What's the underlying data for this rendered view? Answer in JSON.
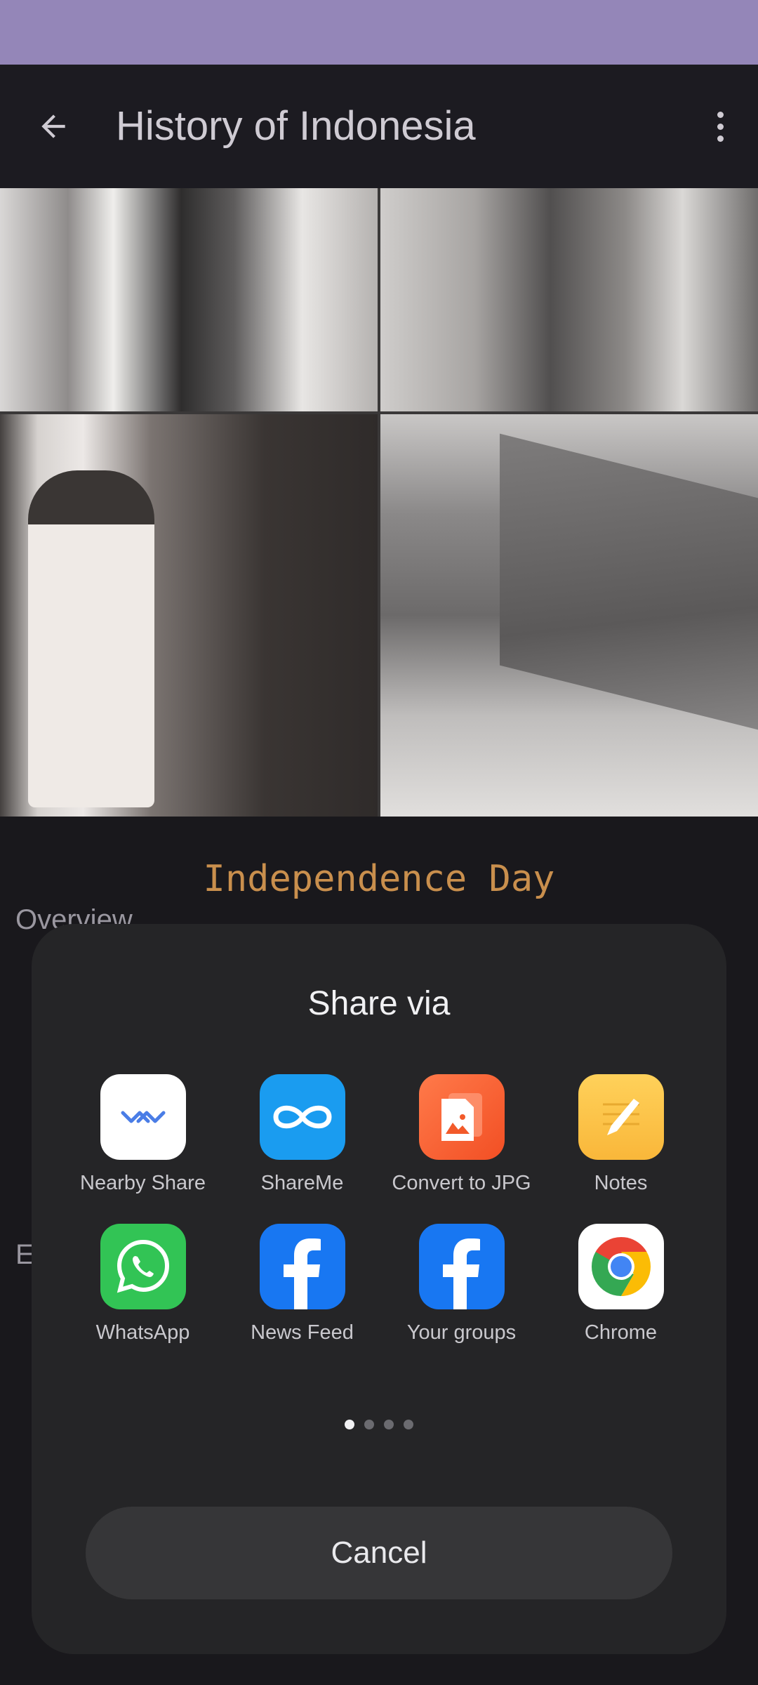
{
  "appbar": {
    "title": "History of Indonesia"
  },
  "content": {
    "section_title": "Independence Day",
    "overview_label": "Overview",
    "truncated_label": "E"
  },
  "share_sheet": {
    "title": "Share via",
    "apps": [
      {
        "label": "Nearby Share",
        "icon": "nearby-share-icon"
      },
      {
        "label": "ShareMe",
        "icon": "shareme-icon"
      },
      {
        "label": "Convert to JPG",
        "icon": "convert-to-jpg-icon"
      },
      {
        "label": "Notes",
        "icon": "notes-icon"
      },
      {
        "label": "WhatsApp",
        "icon": "whatsapp-icon"
      },
      {
        "label": "News Feed",
        "icon": "facebook-icon"
      },
      {
        "label": "Your groups",
        "icon": "facebook-icon"
      },
      {
        "label": "Chrome",
        "icon": "chrome-icon"
      }
    ],
    "page_indicator": {
      "current": 1,
      "total": 4
    },
    "cancel_label": "Cancel"
  },
  "colors": {
    "status_bar": "#9486b8",
    "accent_title": "#c98f4d",
    "sheet_bg": "#252527"
  }
}
